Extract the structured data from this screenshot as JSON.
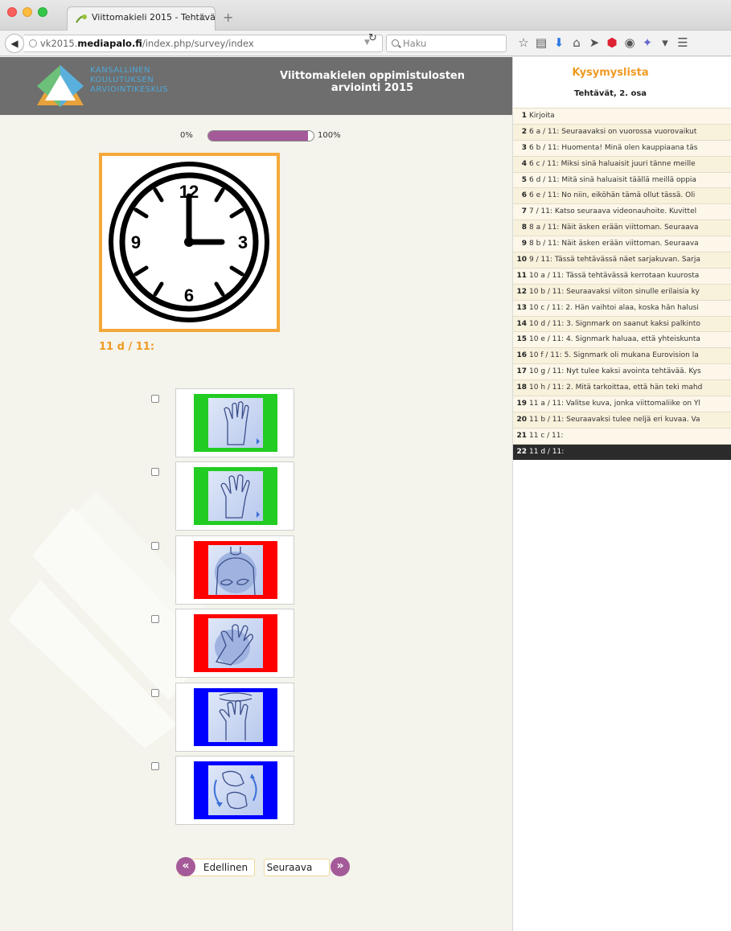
{
  "browser": {
    "tab_title": "Viittomakieli 2015 - Tehtävä...",
    "tab_close": "×",
    "new_tab": "+",
    "url_prefix": "vk2015.",
    "url_domain": "mediapalo.fi",
    "url_path": "/index.php/survey/index",
    "search_placeholder": "Haku"
  },
  "header": {
    "logo_lines": [
      "KANSALLINEN",
      "KOULUTUKSEN",
      "ARVIOINTIKESKUS"
    ],
    "title": "Viittomakielen oppimistulosten arviointi 2015"
  },
  "progress": {
    "min_label": "0%",
    "max_label": "100%",
    "value": 0.95,
    "fill_color": "#a45a98"
  },
  "question": {
    "label": "11 d / 11:",
    "clock_numbers": [
      "12",
      "3",
      "6",
      "9"
    ]
  },
  "options": [
    {
      "frame_color": "#22cc22",
      "icon": "raised-palm-hand-sign-icon"
    },
    {
      "frame_color": "#22cc22",
      "icon": "open-hand-sign-icon"
    },
    {
      "frame_color": "#ff0000",
      "icon": "signing-person-sign-icon"
    },
    {
      "frame_color": "#ff0000",
      "icon": "tilted-hand-sign-icon"
    },
    {
      "frame_color": "#0000ff",
      "icon": "spread-fingers-hand-sign-icon"
    },
    {
      "frame_color": "#0000ff",
      "icon": "rotating-fists-sign-icon"
    }
  ],
  "nav": {
    "prev_label": "Edellinen",
    "next_label": "Seuraava",
    "prev_glyph": "«",
    "next_glyph": "»"
  },
  "sidebar": {
    "title": "Kysymyslista",
    "subtitle": "Tehtävät, 2. osa",
    "items": [
      {
        "num": "1",
        "text": "Kirjoita"
      },
      {
        "num": "2",
        "text": "6 a / 11: Seuraavaksi on vuorossa vuorovaikut"
      },
      {
        "num": "3",
        "text": "6 b / 11: Huomenta! Minä olen kauppiaana täs"
      },
      {
        "num": "4",
        "text": "6 c / 11: Miksi sinä haluaisit juuri tänne meille"
      },
      {
        "num": "5",
        "text": "6 d / 11: Mitä sinä haluaisit täällä meillä oppia"
      },
      {
        "num": "6",
        "text": "6 e / 11: No niin, eiköhän tämä ollut tässä. Oli"
      },
      {
        "num": "7",
        "text": "7 / 11: Katso seuraava videonauhoite. Kuvittel"
      },
      {
        "num": "8",
        "text": "8 a / 11: Näit äsken erään viittoman. Seuraava"
      },
      {
        "num": "9",
        "text": "8 b / 11: Näit äsken erään viittoman. Seuraava"
      },
      {
        "num": "10",
        "text": "9 / 11: Tässä tehtävässä näet sarjakuvan. Sarja"
      },
      {
        "num": "11",
        "text": "10 a / 11: Tässä tehtävässä kerrotaan kuurosta"
      },
      {
        "num": "12",
        "text": "10 b / 11: Seuraavaksi viiton sinulle erilaisia ky"
      },
      {
        "num": "13",
        "text": "10 c / 11: 2. Hän vaihtoi alaa, koska hän halusi"
      },
      {
        "num": "14",
        "text": "10 d / 11: 3. Signmark on saanut kaksi palkinto"
      },
      {
        "num": "15",
        "text": "10 e / 11: 4. Signmark haluaa, että yhteiskunta"
      },
      {
        "num": "16",
        "text": "10 f / 11: 5. Signmark oli mukana Eurovision la"
      },
      {
        "num": "17",
        "text": "10 g / 11: Nyt tulee kaksi avointa tehtävää. Kys"
      },
      {
        "num": "18",
        "text": "10 h / 11: 2. Mitä tarkoittaa, että hän teki mahd"
      },
      {
        "num": "19",
        "text": "11 a / 11: Valitse kuva, jonka viittomaliike on Yl"
      },
      {
        "num": "20",
        "text": "11 b / 11: Seuraavaksi tulee neljä eri kuvaa. Va"
      },
      {
        "num": "21",
        "text": "11 c / 11:"
      },
      {
        "num": "22",
        "text": "11 d / 11:"
      }
    ],
    "active_index": 21
  }
}
